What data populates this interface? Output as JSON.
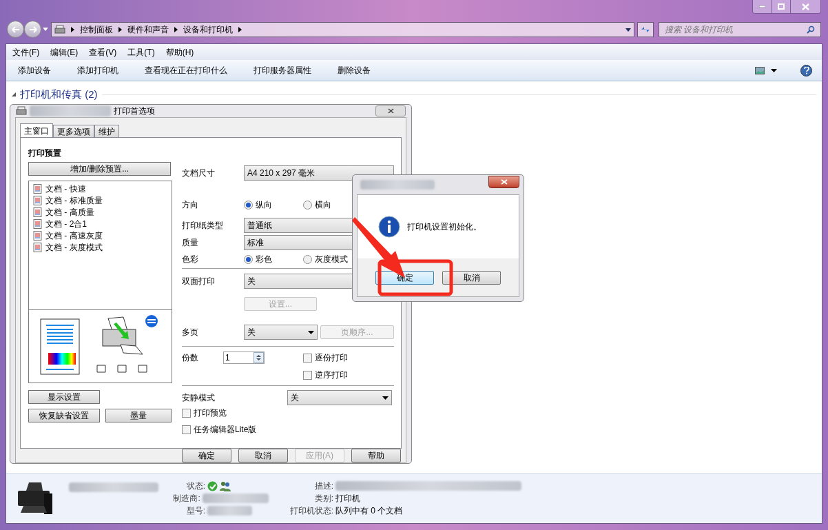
{
  "window": {
    "breadcrumb": [
      "控制面板",
      "硬件和声音",
      "设备和打印机"
    ],
    "search": {
      "placeholder": "搜索 设备和打印机"
    }
  },
  "menu": [
    "文件(F)",
    "编辑(E)",
    "查看(V)",
    "工具(T)",
    "帮助(H)"
  ],
  "commands": [
    "添加设备",
    "添加打印机",
    "查看现在正在打印什么",
    "打印服务器属性",
    "删除设备"
  ],
  "group": {
    "title": "打印机和传真 (2)",
    "expanded": true
  },
  "print_dialog": {
    "title": "打印首选项",
    "tabs": [
      {
        "label": "主窗口",
        "selected": true
      },
      {
        "label": "更多选项",
        "selected": false
      },
      {
        "label": "维护",
        "selected": false
      }
    ],
    "presets_heading": "打印预置",
    "presets_button": "增加/删除预置...",
    "presets": [
      {
        "label": "文档 - 快速"
      },
      {
        "label": "文档 - 标准质量"
      },
      {
        "label": "文档 - 高质量"
      },
      {
        "label": "文档 - 2合1"
      },
      {
        "label": "文档 - 高速灰度"
      },
      {
        "label": "文档 - 灰度模式"
      }
    ],
    "left_buttons": [
      "显示设置",
      "恢复缺省设置",
      "墨量"
    ],
    "paper_size": {
      "label": "文档尺寸",
      "value": "A4 210 x 297 毫米"
    },
    "orientation": {
      "label": "方向",
      "options": [
        {
          "label": "纵向",
          "selected": true
        },
        {
          "label": "横向",
          "selected": false
        }
      ]
    },
    "paper_type": {
      "label": "打印纸类型",
      "value": "普通纸"
    },
    "quality": {
      "label": "质量",
      "value": "标准"
    },
    "color": {
      "label": "色彩",
      "options": [
        {
          "label": "彩色",
          "selected": true
        },
        {
          "label": "灰度模式",
          "selected": false
        }
      ]
    },
    "duplex": {
      "label": "双面打印",
      "value": "关",
      "button": {
        "label": "设置...",
        "disabled": true
      }
    },
    "multipage": {
      "label": "多页",
      "value": "关",
      "button": {
        "label": "页顺序...",
        "disabled": true
      }
    },
    "copies": {
      "label": "份数",
      "value": "1"
    },
    "copy_options": [
      {
        "label": "逐份打印",
        "checked": false
      },
      {
        "label": "逆序打印",
        "checked": false
      }
    ],
    "quiet": {
      "label": "安静模式",
      "value": "关"
    },
    "extra_options": [
      {
        "label": "打印预览",
        "checked": false
      },
      {
        "label": "任务编辑器Lite版",
        "checked": false
      }
    ],
    "footer": [
      {
        "label": "确定",
        "disabled": false
      },
      {
        "label": "取消",
        "disabled": false
      },
      {
        "label": "应用(A)",
        "disabled": true
      },
      {
        "label": "帮助",
        "disabled": false
      }
    ]
  },
  "message_box": {
    "text": "打印机设置初始化。",
    "buttons": [
      {
        "label": "确定",
        "selected": true
      },
      {
        "label": "取消",
        "selected": false
      }
    ]
  },
  "details": {
    "left": [
      {
        "label": "状态:",
        "kind": "status"
      },
      {
        "label": "制造商:",
        "kind": "blurred"
      },
      {
        "label": "型号:",
        "kind": "blurred"
      }
    ],
    "right": [
      {
        "label": "描述:",
        "kind": "blurred"
      },
      {
        "label": "类别:",
        "value": "打印机",
        "kind": "text"
      },
      {
        "label": "打印机状态:",
        "value": "队列中有 0 个文档",
        "kind": "text"
      }
    ]
  }
}
